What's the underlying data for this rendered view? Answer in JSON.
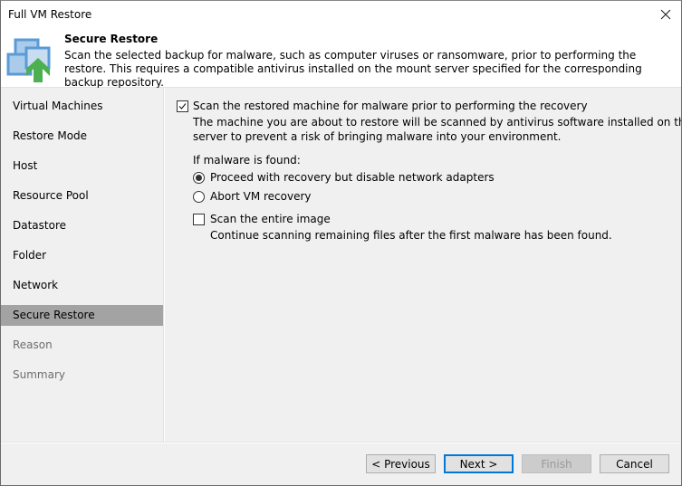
{
  "window": {
    "title": "Full VM Restore",
    "close_icon": "close-icon"
  },
  "header": {
    "icon": "vm-restore-upload-icon",
    "title": "Secure Restore",
    "description": "Scan the selected backup for malware, such as computer viruses or ransomware, prior to performing the restore. This requires a compatible antivirus installed on the mount server specified for the corresponding backup repository."
  },
  "sidebar": {
    "items": [
      {
        "label": "Virtual Machines",
        "state": "normal"
      },
      {
        "label": "Restore Mode",
        "state": "normal"
      },
      {
        "label": "Host",
        "state": "normal"
      },
      {
        "label": "Resource Pool",
        "state": "normal"
      },
      {
        "label": "Datastore",
        "state": "normal"
      },
      {
        "label": "Folder",
        "state": "normal"
      },
      {
        "label": "Network",
        "state": "normal"
      },
      {
        "label": "Secure Restore",
        "state": "active"
      },
      {
        "label": "Reason",
        "state": "disabled"
      },
      {
        "label": "Summary",
        "state": "disabled"
      }
    ]
  },
  "content": {
    "scan_checkbox": {
      "label": "Scan the restored machine for malware prior to performing the recovery",
      "checked": true,
      "description_line1": "The machine you are about to restore will be scanned by antivirus software installed on the mount",
      "description_line2": "server to prevent a risk of bringing malware into your environment."
    },
    "malware_found_label": "If malware is found:",
    "radio_options": [
      {
        "label": "Proceed with recovery but disable network adapters",
        "selected": true
      },
      {
        "label": "Abort VM recovery",
        "selected": false
      }
    ],
    "entire_image_checkbox": {
      "label": "Scan the entire image",
      "checked": false,
      "description": "Continue scanning remaining files after the first malware has been found."
    }
  },
  "footer": {
    "previous_label": "< Previous",
    "next_label": "Next >",
    "finish_label": "Finish",
    "cancel_label": "Cancel"
  },
  "colors": {
    "accent": "#0078d7",
    "active_nav": "#a3a3a3",
    "icon_green": "#4caf50",
    "icon_blue": "#5b9bd5"
  }
}
